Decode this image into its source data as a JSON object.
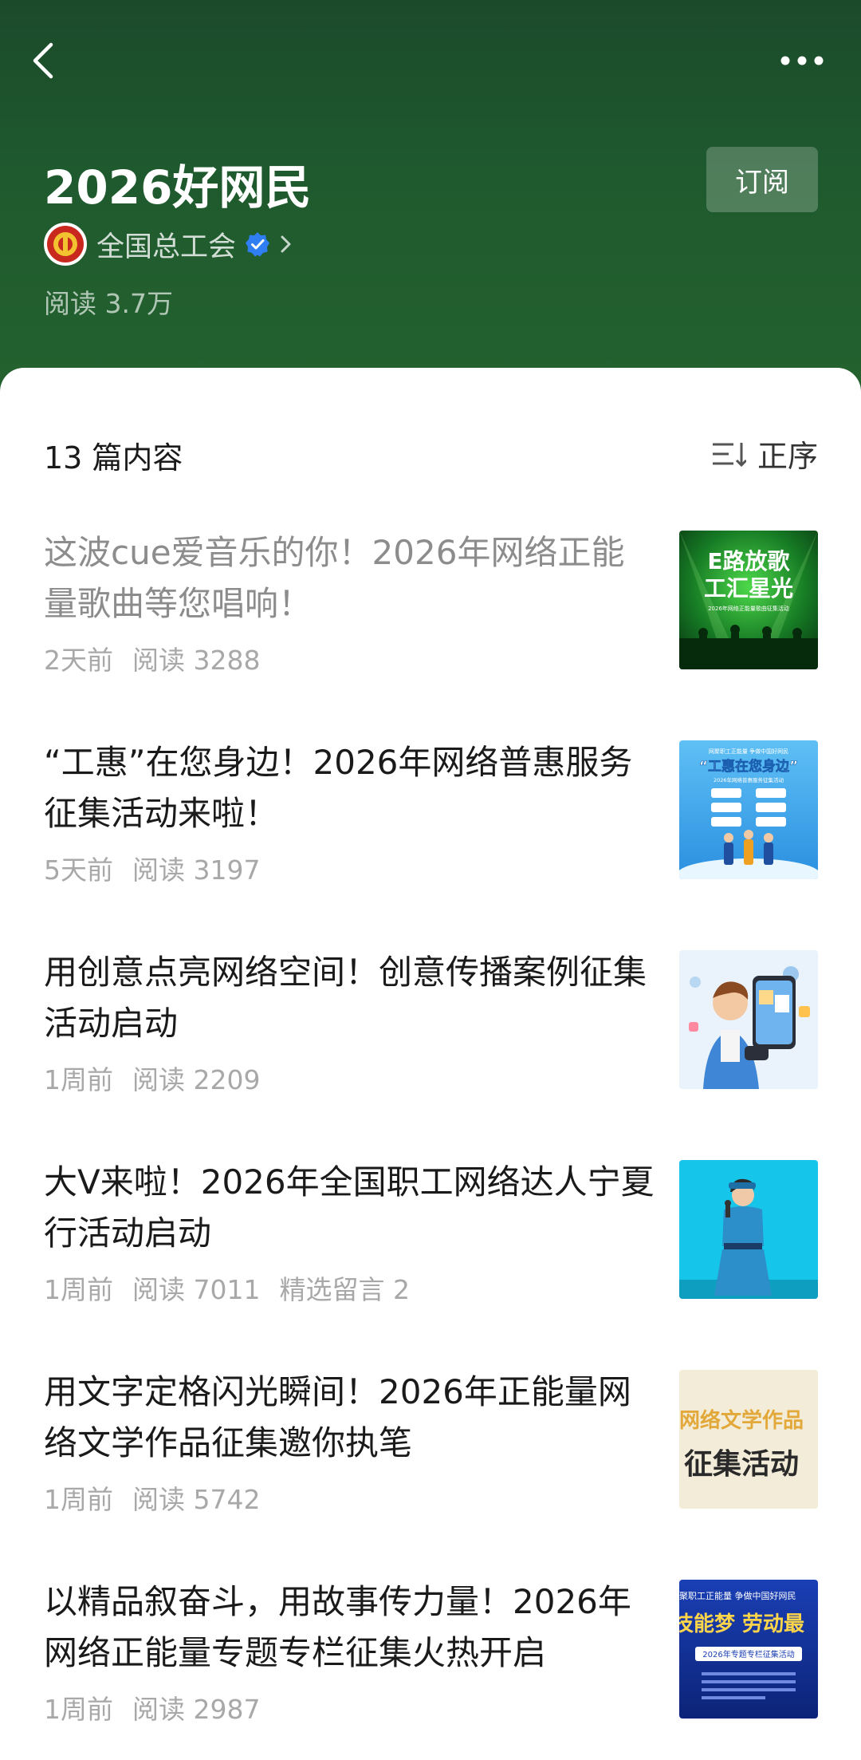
{
  "header": {
    "title": "2026好网民",
    "subscribe_label": "订阅",
    "account_name": "全国总工会",
    "reads": "阅读 3.7万"
  },
  "list": {
    "count_label": "13 篇内容",
    "sort_label": "正序"
  },
  "colors": {
    "header_green": "#1f5a2e",
    "verified_blue": "#2f7ff2"
  },
  "articles": [
    {
      "title": "这波cue爱音乐的你！2026年网络正能量歌曲等您唱响！",
      "time": "2天前",
      "reads": "阅读 3288",
      "comments": "",
      "read_state": "read",
      "thumb": {
        "line1": "E路放歌",
        "line2": "工汇星光",
        "caption": "2026年网络正能量歌曲征集活动"
      }
    },
    {
      "title": "“工惠”在您身边！2026年网络普惠服务征集活动来啦！",
      "time": "5天前",
      "reads": "阅读 3197",
      "comments": "",
      "read_state": "unread",
      "thumb": {
        "top": "网聚职工正能量 争做中国好网民",
        "banner": "“工惠在您身边”",
        "caption": "2026年网络普惠服务征集活动"
      }
    },
    {
      "title": "用创意点亮网络空间！创意传播案例征集活动启动",
      "time": "1周前",
      "reads": "阅读 2209",
      "comments": "",
      "read_state": "unread"
    },
    {
      "title": "大V来啦！2026年全国职工网络达人宁夏行活动启动",
      "time": "1周前",
      "reads": "阅读 7011",
      "comments": "精选留言 2",
      "read_state": "unread"
    },
    {
      "title": "用文字定格闪光瞬间！2026年正能量网络文学作品征集邀你执笔",
      "time": "1周前",
      "reads": "阅读 5742",
      "comments": "",
      "read_state": "unread",
      "thumb": {
        "line1": "网络文学作品",
        "line2": "征集活动"
      }
    },
    {
      "title": "以精品叙奋斗，用故事传力量！2026年网络正能量专题专栏征集火热开启",
      "time": "1周前",
      "reads": "阅读 2987",
      "comments": "",
      "read_state": "unread",
      "thumb": {
        "top": "聚职工正能量 争做中国好网民",
        "middle": "技能梦 劳动最",
        "caption": "2026年专题专栏征集活动"
      }
    }
  ]
}
